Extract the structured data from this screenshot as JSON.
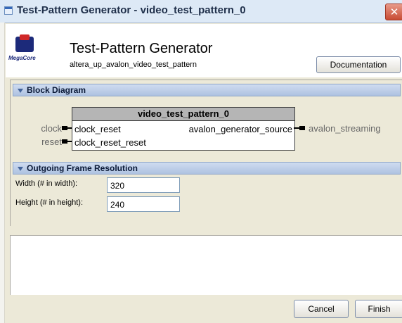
{
  "window": {
    "title": "Test-Pattern Generator - video_test_pattern_0",
    "close_glyph": "✕"
  },
  "header": {
    "logo_text": "MegaCore",
    "title": "Test-Pattern Generator",
    "subtitle": "altera_up_avalon_video_test_pattern",
    "documentation_label": "Documentation"
  },
  "block_diagram": {
    "section_label": "Block Diagram",
    "component_name": "video_test_pattern_0",
    "ports": {
      "left": [
        {
          "external": "clock",
          "internal": "clock_reset"
        },
        {
          "external": "reset",
          "internal": "clock_reset_reset"
        }
      ],
      "right": {
        "internal": "avalon_generator_source",
        "external": "avalon_streaming"
      }
    }
  },
  "resolution": {
    "section_label": "Outgoing Frame Resolution",
    "width_label": "Width (# in width):",
    "width_value": "320",
    "height_label": "Height (# in height):",
    "height_value": "240"
  },
  "footer": {
    "cancel_label": "Cancel",
    "finish_label": "Finish"
  }
}
